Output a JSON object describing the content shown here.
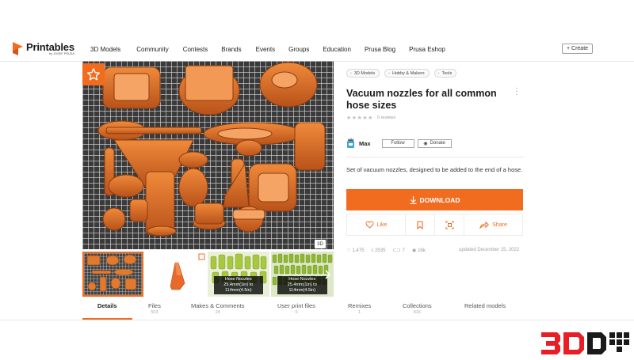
{
  "brand": {
    "name": "Printables",
    "sub": "by JOSEF PRUSA",
    "accent": "#f26c1f"
  },
  "nav": {
    "items": [
      "3D Models",
      "Community",
      "Contests",
      "Brands",
      "Events",
      "Groups",
      "Education",
      "Prusa Blog",
      "Prusa Eshop"
    ],
    "create_label": "Create"
  },
  "gallery": {
    "badge_3d": "3D",
    "thumb_captions": [
      "Hose Nozzles 25.4mm(1in) to 114mm(4.5in)",
      "Hose Nozzles 25.4mm(1in) to 114mm(4.5in)"
    ]
  },
  "model": {
    "breadcrumbs": [
      "3D Models",
      "Hobby & Makers",
      "Tools"
    ],
    "title": "Vacuum nozzles for all common hose sizes",
    "reviews": "0 reviews",
    "author": "Max",
    "follow_label": "Follow",
    "donate_label": "Donate",
    "description": "Set of vacuum nozzles, designed to be added to the end of a hose.",
    "download_label": "DOWNLOAD",
    "like_label": "Like",
    "share_label": "Share",
    "stats": {
      "likes": "1,475",
      "downloads": "2535",
      "makes": "7",
      "views": "16k"
    },
    "updated": "updated December 15, 2022"
  },
  "tabs": [
    {
      "label": "Details",
      "count": ""
    },
    {
      "label": "Files",
      "count": "503"
    },
    {
      "label": "Makes & Comments",
      "count": "24"
    },
    {
      "label": "User print files",
      "count": "0"
    },
    {
      "label": "Remixes",
      "count": "1"
    },
    {
      "label": "Collections",
      "count": "816"
    },
    {
      "label": "Related models",
      "count": ""
    }
  ],
  "watermark": "3D"
}
